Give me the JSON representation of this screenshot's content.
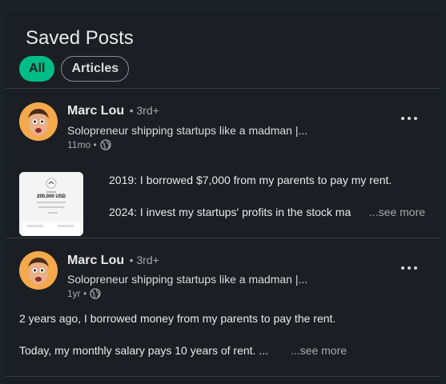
{
  "header": {
    "title": "Saved Posts"
  },
  "filters": [
    {
      "label": "All",
      "active": true
    },
    {
      "label": "Articles",
      "active": false
    }
  ],
  "posts": [
    {
      "author": "Marc Lou",
      "degree": "• 3rd+",
      "headline": "Solopreneur shipping startups like a madman |...",
      "time": "11mo •",
      "visibility_icon": "globe-icon",
      "thumbnail_text": "200,000 USD",
      "lines": [
        "2019: I borrowed $7,000 from my parents to pay my rent.",
        "2024: I invest my startups' profits in the stock ma"
      ],
      "see_more": "...see more"
    },
    {
      "author": "Marc Lou",
      "degree": "• 3rd+",
      "headline": "Solopreneur shipping startups like a madman |...",
      "time": "1yr •",
      "visibility_icon": "globe-icon",
      "lines": [
        "2 years ago, I borrowed money from my parents to pay the rent.",
        "Today, my monthly salary pays 10 years of rent. ..."
      ],
      "see_more": "...see more"
    }
  ],
  "colors": {
    "accent": "#00bd88",
    "card": "#1b1f23",
    "avatar_bg": "#f3a94c"
  }
}
